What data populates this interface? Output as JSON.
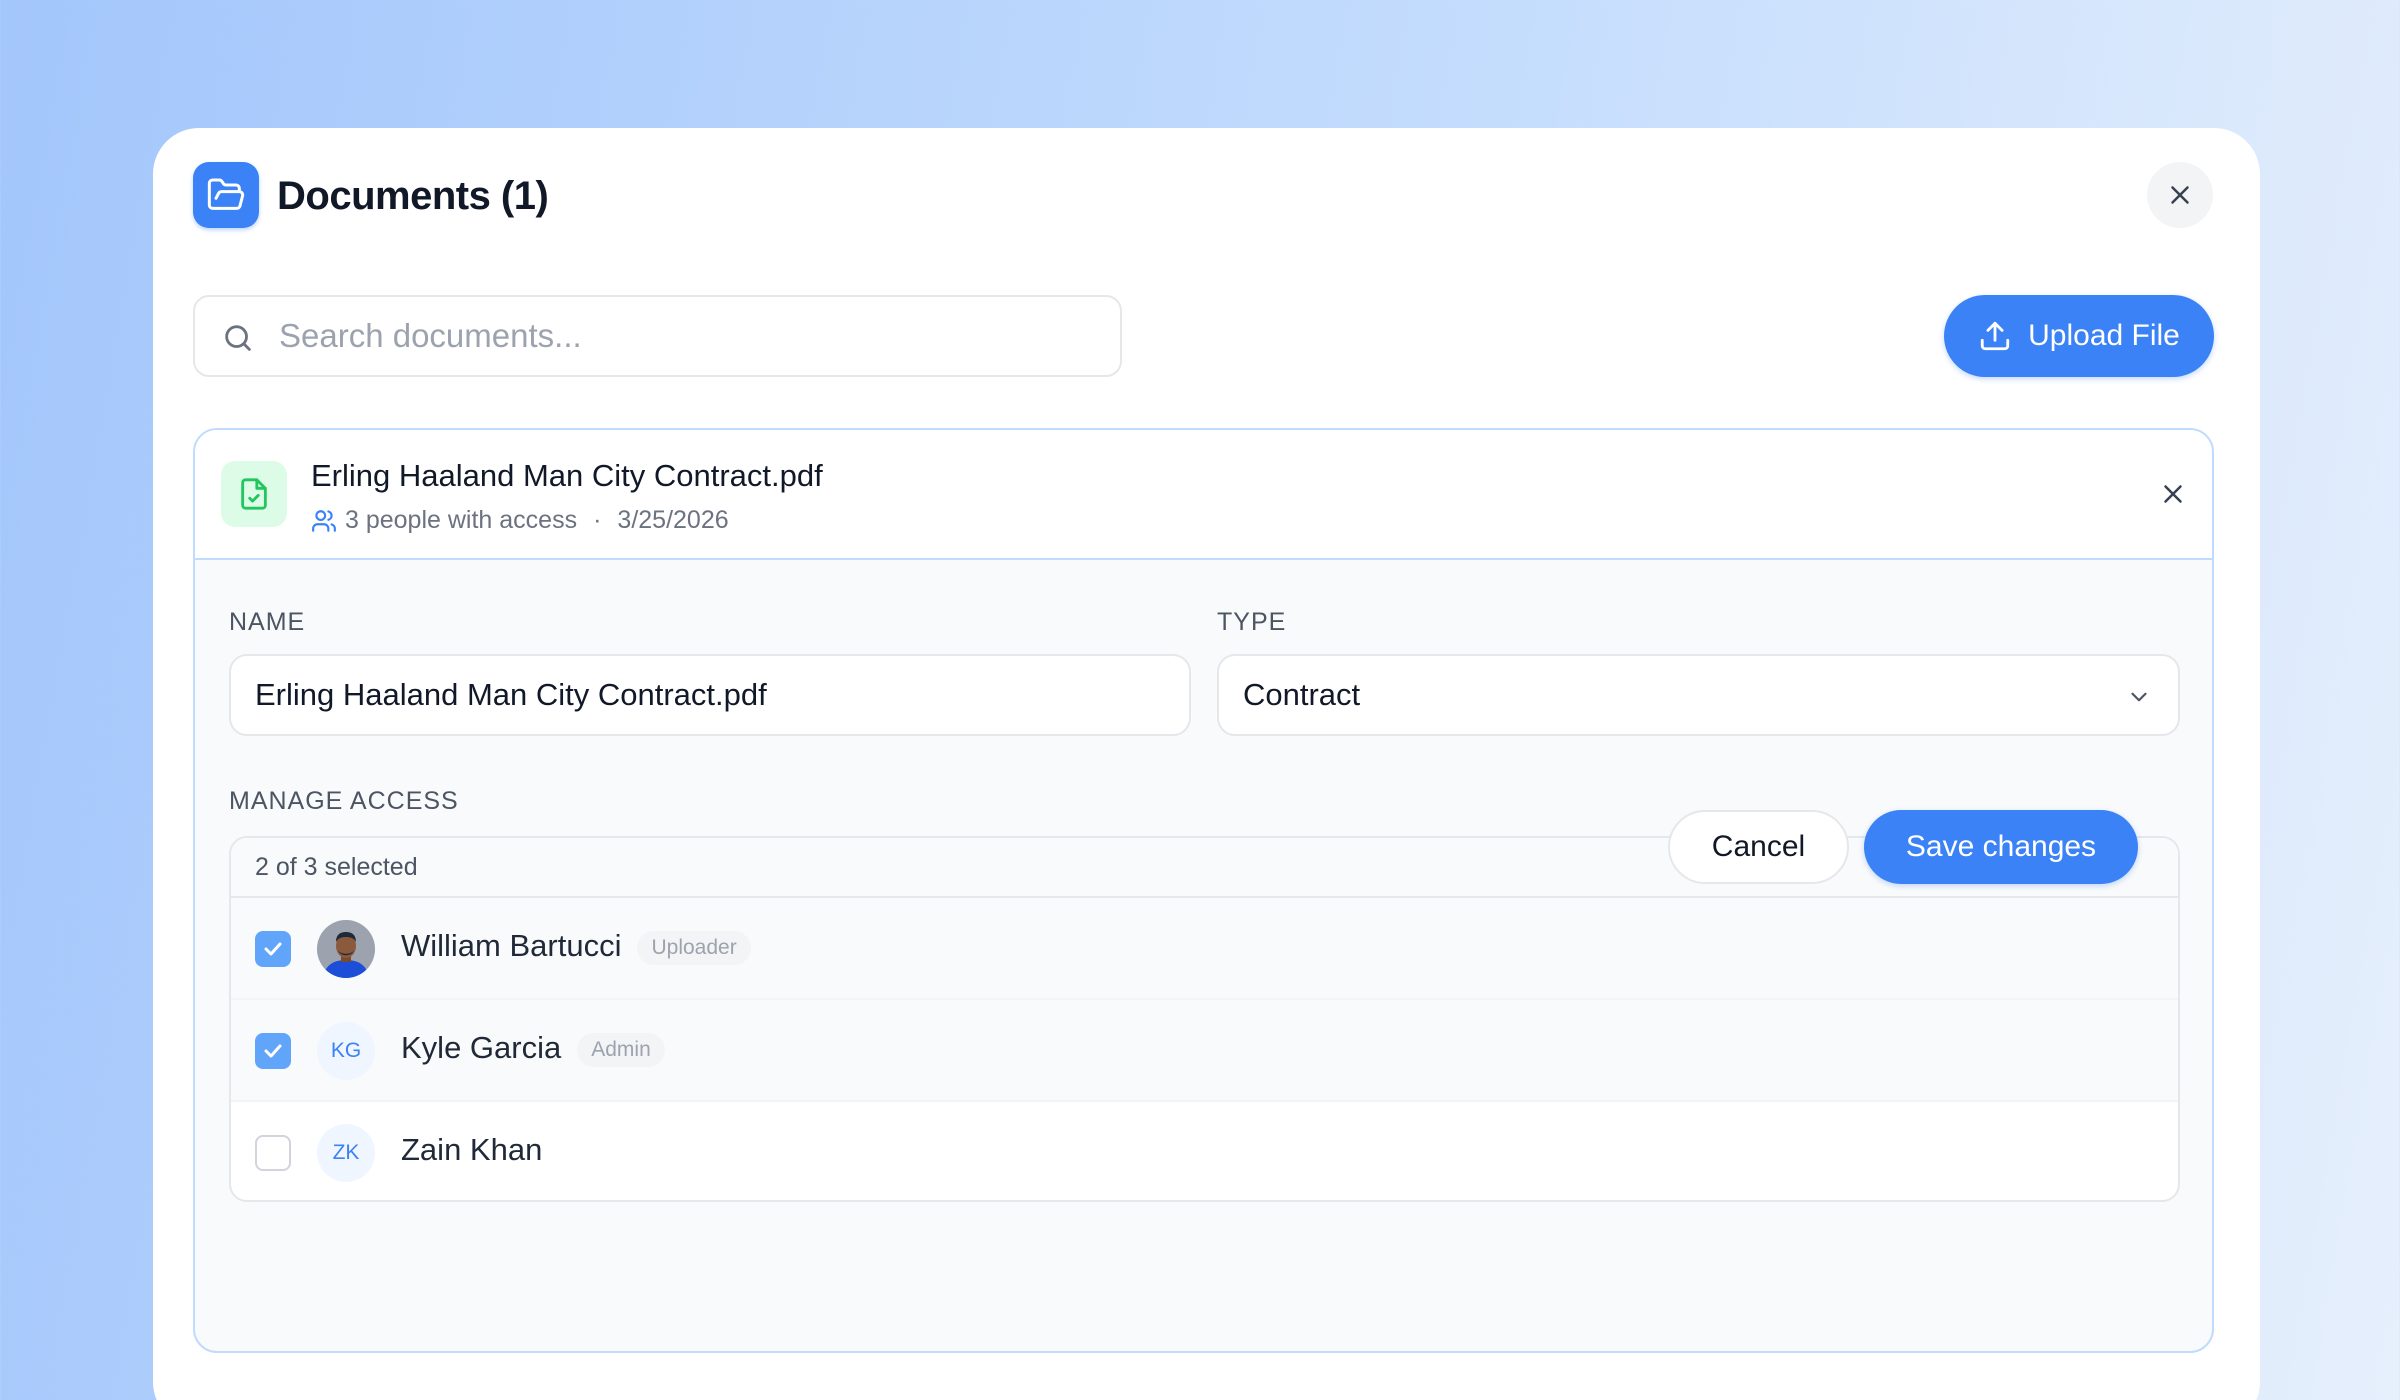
{
  "modal": {
    "title": "Documents (1)",
    "icons": {
      "header": "folder-open-icon",
      "close": "close-icon"
    }
  },
  "search": {
    "placeholder": "Search documents...",
    "value": ""
  },
  "upload": {
    "label": "Upload File",
    "icon": "upload-icon"
  },
  "document": {
    "name": "Erling Haaland Man City Contract.pdf",
    "access_text": "3 people with access",
    "separator": "·",
    "date": "3/25/2026",
    "icon": "file-check-icon"
  },
  "form": {
    "name_label": "NAME",
    "name_value": "Erling Haaland Man City Contract.pdf",
    "type_label": "TYPE",
    "type_value": "Contract",
    "access_label": "MANAGE ACCESS",
    "selected_text": "2 of 3 selected"
  },
  "people": [
    {
      "name": "William Bartucci",
      "role": "Uploader",
      "initials": "",
      "checked": true
    },
    {
      "name": "Kyle Garcia",
      "role": "Admin",
      "initials": "KG",
      "checked": true
    },
    {
      "name": "Zain Khan",
      "role": "",
      "initials": "ZK",
      "checked": false
    }
  ],
  "actions": {
    "cancel": "Cancel",
    "save": "Save changes"
  },
  "colors": {
    "accent": "#3b82f6",
    "checkbox": "#60a5fa",
    "file_bg": "#dcfce7",
    "file_icon": "#22c55e",
    "card_border": "#bfdbfe"
  }
}
